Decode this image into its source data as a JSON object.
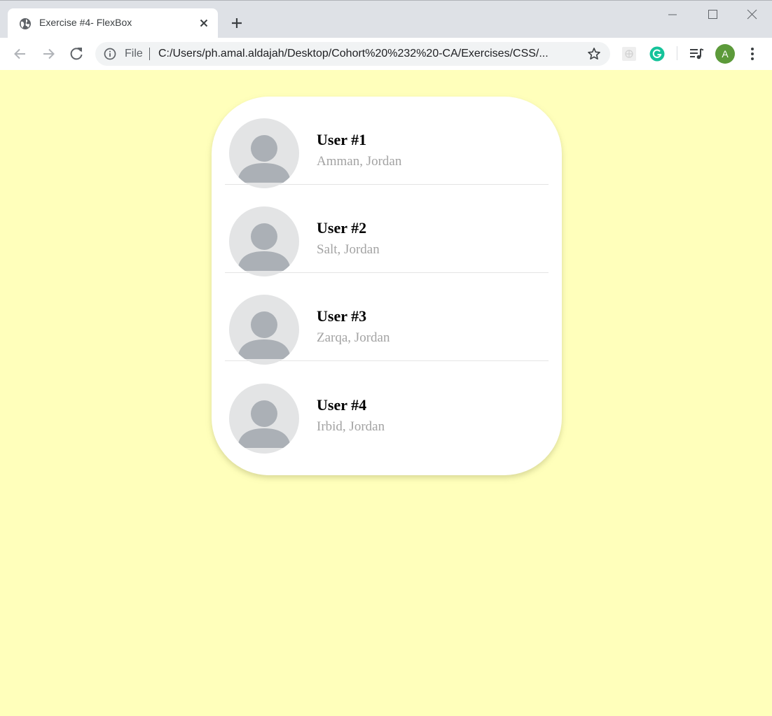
{
  "browser": {
    "tab_title": "Exercise #4- FlexBox",
    "address_scheme": "File",
    "address_url": "C:/Users/ph.amal.aldajah/Desktop/Cohort%20%232%20-CA/Exercises/CSS/...",
    "profile_initial": "A",
    "profile_color": "#5c9a3a",
    "icons": [
      "globe-icon",
      "close-icon",
      "plus-icon",
      "minimize-icon",
      "maximize-icon",
      "window-close-icon",
      "back-arrow-icon",
      "forward-arrow-icon",
      "reload-icon",
      "info-icon",
      "star-icon",
      "extension-icon",
      "grammarly-icon",
      "media-playlist-icon",
      "kebab-menu-icon"
    ]
  },
  "page": {
    "background": "#ffffbb",
    "users": [
      {
        "name": "User #1",
        "location": "Amman, Jordan"
      },
      {
        "name": "User #2",
        "location": "Salt, Jordan"
      },
      {
        "name": "User #3",
        "location": "Zarqa, Jordan"
      },
      {
        "name": "User #4",
        "location": "Irbid, Jordan"
      }
    ]
  }
}
